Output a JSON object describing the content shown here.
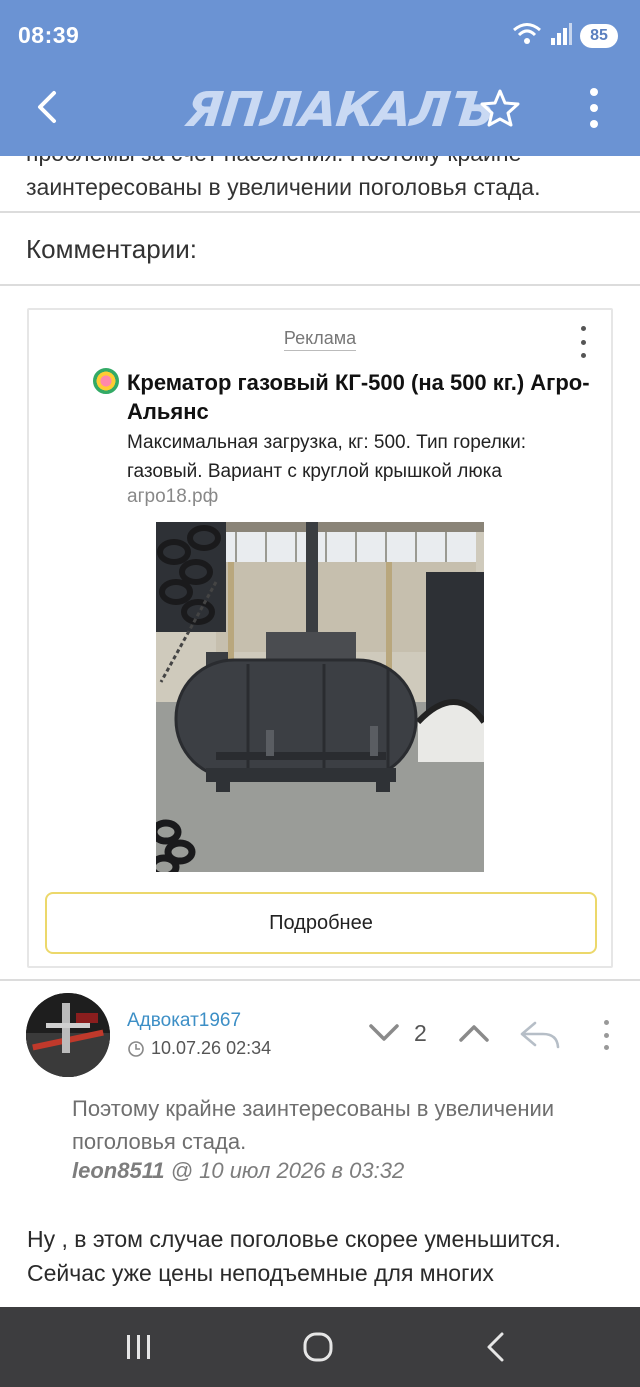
{
  "status_bar": {
    "time": "08:39",
    "battery": "85",
    "icons": [
      "wifi-icon",
      "signal-icon"
    ]
  },
  "app_bar": {
    "logo": "ЯПЛАКАЛЪ",
    "icons": [
      "back-arrow-icon",
      "star-icon",
      "more-vert-icon"
    ]
  },
  "article": {
    "tail_line_1": "проблемы за счёт населения. Поэтому крайне",
    "tail_line_2": "заинтересованы в увеличении поголовья стада."
  },
  "comments": {
    "title": "Комментарии:"
  },
  "ad": {
    "label": "Реклама",
    "title": "Крематор газовый КГ-500 (на 500 кг.) Агро-Альянс",
    "description": "Максимальная загрузка, кг: 500. Тип горелки: газовый. Вариант с круглой крышкой люка",
    "domain": "агро18.рф",
    "button_label": "Подробнее"
  },
  "comment": {
    "author": "Адвокат1967",
    "date": "10.07.26 02:34",
    "vote_count": "2",
    "quote_text": "Поэтому крайне заинтересованы в увеличении поголовья стада.",
    "quote_author": "leon8511",
    "quote_meta": " @ 10 июл 2026 в 03:32",
    "body_line_1": "Ну , в этом случае поголовье скорее уменьшится.",
    "body_line_2": "Сейчас уже цены неподъемные для многих"
  },
  "colors": {
    "app_bar": "#6b93d3",
    "link": "#3d8fc6",
    "ad_button_border": "#ecd86b",
    "nav_bar": "#3d3d3f"
  }
}
